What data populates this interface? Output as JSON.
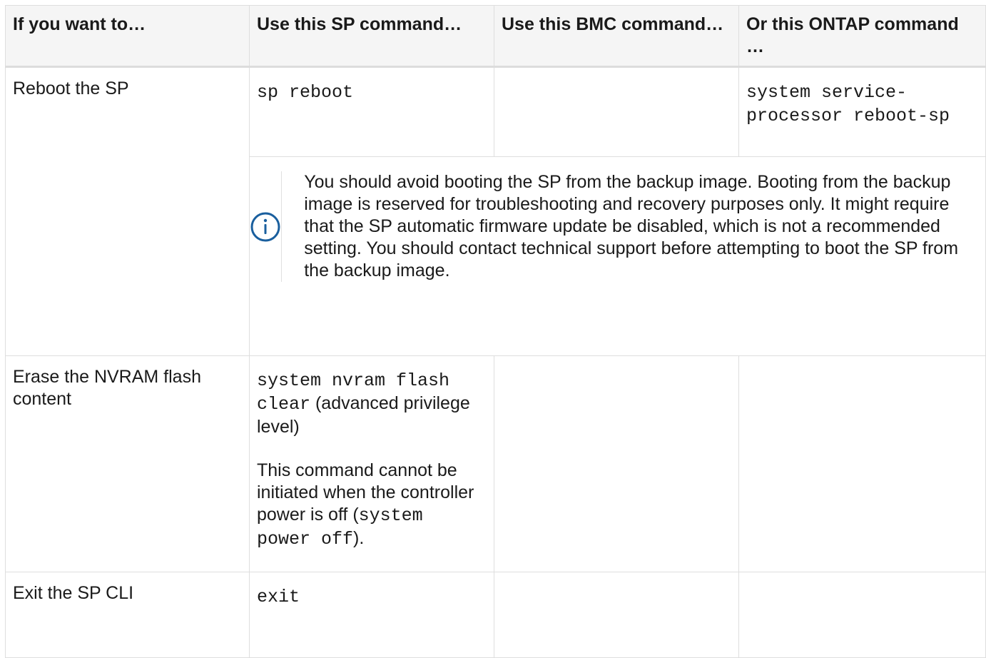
{
  "table": {
    "headers": [
      "If you want to…",
      "Use this SP command…",
      "Use this BMC command…",
      "Or this ONTAP command …"
    ],
    "rows": [
      {
        "action": "Reboot the SP",
        "sp_command": "sp reboot",
        "bmc_command": "",
        "ontap_command": "system service-processor reboot-sp",
        "note": "You should avoid booting the SP from the backup image. Booting from the backup image is reserved for troubleshooting and recovery purposes only. It might require that the SP automatic firmware update be disabled, which is not a recommended setting. You should contact technical support before attempting to boot the SP from the backup image.",
        "note_icon": "info-icon"
      },
      {
        "action": "Erase the NVRAM flash content",
        "sp_command_code": "system nvram flash clear",
        "sp_command_suffix": " (advanced privilege level)",
        "sp_command_note_prefix": "This command cannot be initiated when the controller power is off (",
        "sp_command_note_code": "system power off",
        "sp_command_note_suffix": ").",
        "bmc_command": "",
        "ontap_command": ""
      },
      {
        "action": "Exit the SP CLI",
        "sp_command": "exit",
        "bmc_command": "",
        "ontap_command": ""
      }
    ]
  },
  "colors": {
    "border": "#dedede",
    "header_bg": "#f5f5f5",
    "icon": "#1a5f9e"
  }
}
